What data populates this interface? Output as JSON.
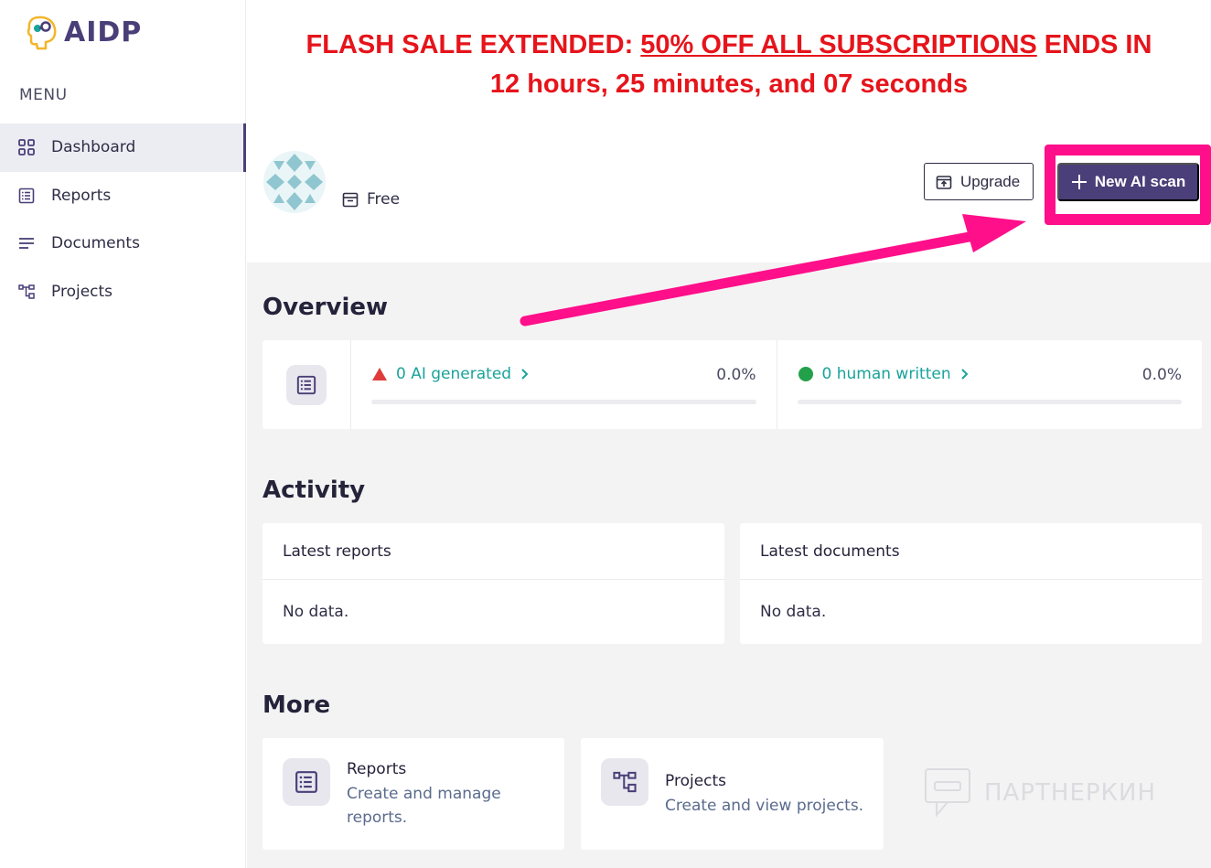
{
  "brand": {
    "name": "AIDP"
  },
  "sidebar": {
    "menu_label": "MENU",
    "items": [
      {
        "label": "Dashboard",
        "icon": "grid-icon",
        "active": true
      },
      {
        "label": "Reports",
        "icon": "list-icon",
        "active": false
      },
      {
        "label": "Documents",
        "icon": "lines-icon",
        "active": false
      },
      {
        "label": "Projects",
        "icon": "flow-icon",
        "active": false
      }
    ]
  },
  "banner": {
    "prefix": "FLASH SALE EXTENDED: ",
    "underlined": "50% OFF ALL SUBSCRIPTIONS",
    "suffix": " ENDS IN",
    "line2": "12 hours, 25 minutes, and 07 seconds",
    "color": "#e6141b"
  },
  "header": {
    "plan": "Free",
    "upgrade_label": "Upgrade",
    "new_scan_label": "New AI scan"
  },
  "overview": {
    "title": "Overview",
    "stats": [
      {
        "label": "0 AI generated",
        "percent": "0.0%",
        "fill": 0,
        "marker": "triangle-warning-icon",
        "marker_color": "#e03b3b"
      },
      {
        "label": "0 human written",
        "percent": "0.0%",
        "fill": 0,
        "marker": "green-dot-icon",
        "marker_color": "#22a14a"
      }
    ]
  },
  "activity": {
    "title": "Activity",
    "reports": {
      "title": "Latest reports",
      "empty": "No data."
    },
    "documents": {
      "title": "Latest documents",
      "empty": "No data."
    }
  },
  "more": {
    "title": "More",
    "cards": [
      {
        "title": "Reports",
        "desc": "Create and manage reports.",
        "icon": "list-icon"
      },
      {
        "title": "Projects",
        "desc": "Create and view projects.",
        "icon": "flow-icon"
      }
    ]
  },
  "watermark": {
    "text": "ПАРТНЕРКИН"
  },
  "colors": {
    "accent": "#4a3f78",
    "teal": "#19a39a",
    "highlight": "#ff0f8a"
  }
}
